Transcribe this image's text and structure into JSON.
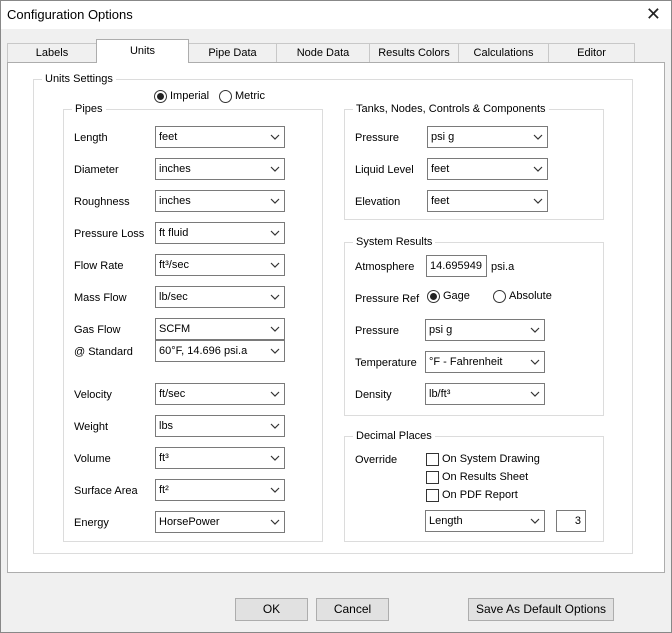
{
  "window": {
    "title": "Configuration Options",
    "close_icon": "close-icon"
  },
  "tabs": [
    {
      "label": "Labels"
    },
    {
      "label": "Units"
    },
    {
      "label": "Pipe Data"
    },
    {
      "label": "Node Data"
    },
    {
      "label": "Results Colors"
    },
    {
      "label": "Calculations"
    },
    {
      "label": "Editor"
    }
  ],
  "active_tab": "Units",
  "units_settings": {
    "title": "Units Settings",
    "system": {
      "imperial": "Imperial",
      "metric": "Metric",
      "selected": "Imperial"
    }
  },
  "pipes": {
    "title": "Pipes",
    "rows": [
      {
        "label": "Length",
        "value": "feet"
      },
      {
        "label": "Diameter",
        "value": "inches"
      },
      {
        "label": "Roughness",
        "value": "inches"
      },
      {
        "label": "Pressure Loss",
        "value": "ft fluid"
      },
      {
        "label": "Flow Rate",
        "value": "ft³/sec"
      },
      {
        "label": "Mass Flow",
        "value": "lb/sec"
      },
      {
        "label": "Gas Flow",
        "value": "SCFM"
      },
      {
        "label": "@ Standard",
        "value": "60°F,  14.696 psi.a"
      },
      {
        "label": "Velocity",
        "value": "ft/sec"
      },
      {
        "label": "Weight",
        "value": "lbs"
      },
      {
        "label": "Volume",
        "value": "ft³"
      },
      {
        "label": "Surface Area",
        "value": "ft²"
      },
      {
        "label": "Energy",
        "value": "HorsePower"
      }
    ]
  },
  "tanks": {
    "title": "Tanks, Nodes, Controls & Components",
    "rows": [
      {
        "label": "Pressure",
        "value": "psi g"
      },
      {
        "label": "Liquid Level",
        "value": "feet"
      },
      {
        "label": "Elevation",
        "value": "feet"
      }
    ]
  },
  "system_results": {
    "title": "System Results",
    "atmosphere_label": "Atmosphere",
    "atmosphere_value": "14.695949",
    "atmosphere_unit": "psi.a",
    "pressure_ref_label": "Pressure Ref",
    "gage": "Gage",
    "absolute": "Absolute",
    "pressure_ref_selected": "Gage",
    "pressure_label": "Pressure",
    "pressure_value": "psi g",
    "temperature_label": "Temperature",
    "temperature_value": "°F - Fahrenheit",
    "density_label": "Density",
    "density_value": "lb/ft³"
  },
  "decimal_places": {
    "title": "Decimal Places",
    "override_label": "Override",
    "options": [
      {
        "label": "On System Drawing",
        "checked": false
      },
      {
        "label": "On Results Sheet",
        "checked": false
      },
      {
        "label": "On PDF Report",
        "checked": false
      }
    ],
    "field_value": "Length",
    "places_value": "3"
  },
  "buttons": {
    "ok": "OK",
    "cancel": "Cancel",
    "save_default": "Save As Default Options"
  }
}
